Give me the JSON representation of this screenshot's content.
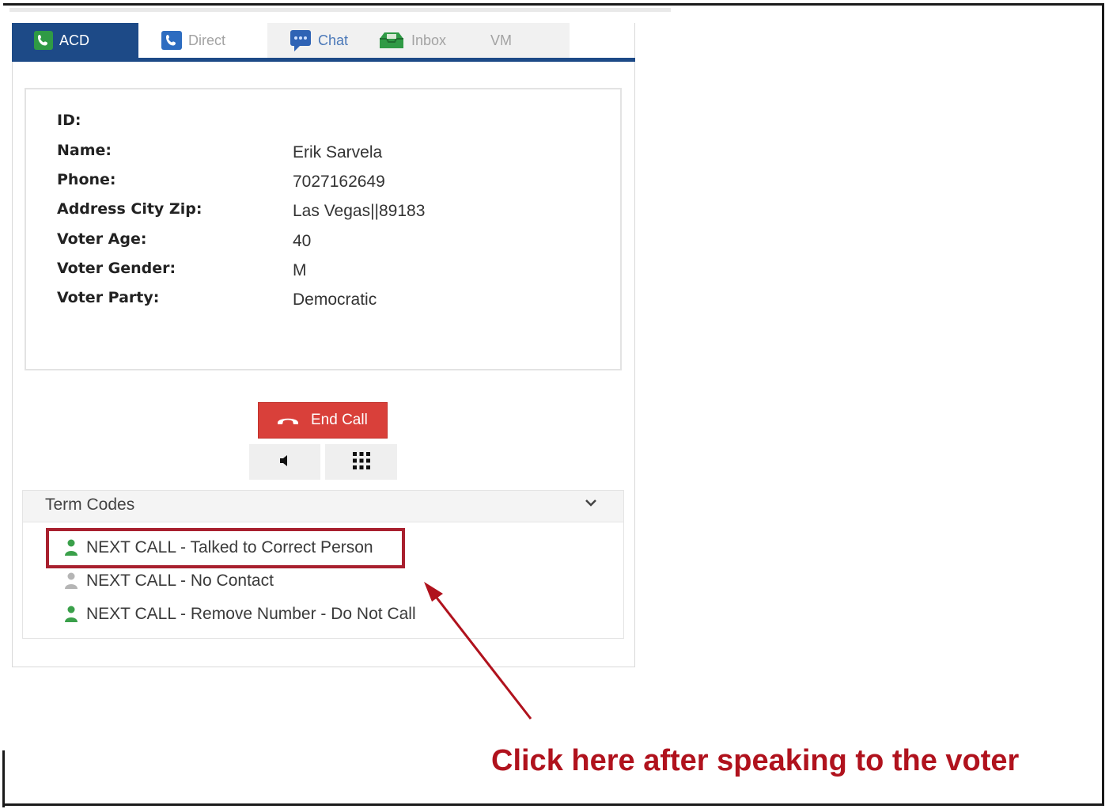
{
  "tabs": [
    {
      "label": "ACD",
      "icon": "phone-icon",
      "active": true
    },
    {
      "label": "Direct",
      "icon": "phone-icon",
      "active": false
    },
    {
      "label": "Chat",
      "icon": "chat-icon",
      "active": false
    },
    {
      "label": "Inbox",
      "icon": "inbox-icon",
      "active": false
    },
    {
      "label": "VM",
      "icon": "",
      "active": false
    }
  ],
  "info": {
    "id_label": "ID:",
    "name_label": "Name:",
    "name_value": "Erik Sarvela",
    "phone_label": "Phone:",
    "phone_value": "7027162649",
    "address_label": "Address City Zip:",
    "address_value": "Las Vegas||89183",
    "age_label": "Voter Age:",
    "age_value": "40",
    "gender_label": "Voter Gender:",
    "gender_value": "M",
    "party_label": "Voter Party:",
    "party_value": "Democratic"
  },
  "controls": {
    "end_call_label": "End Call",
    "end_call_icon": "hangup-icon",
    "speaker_icon": "speaker-icon",
    "keypad_icon": "keypad-icon"
  },
  "term_codes": {
    "title": "Term Codes",
    "items": [
      {
        "label": "NEXT CALL - Talked to Correct Person",
        "icon_color": "#3aa04a"
      },
      {
        "label": "NEXT CALL - No Contact",
        "icon_color": "#b5b5b5"
      },
      {
        "label": "NEXT CALL - Remove Number - Do Not Call",
        "icon_color": "#3aa04a"
      }
    ]
  },
  "annotation": {
    "text": "Click here after speaking to the voter",
    "color": "#b0121d"
  },
  "colors": {
    "tab_active": "#1d4a87",
    "end_call": "#d9403a",
    "highlight_border": "#a8202e"
  }
}
